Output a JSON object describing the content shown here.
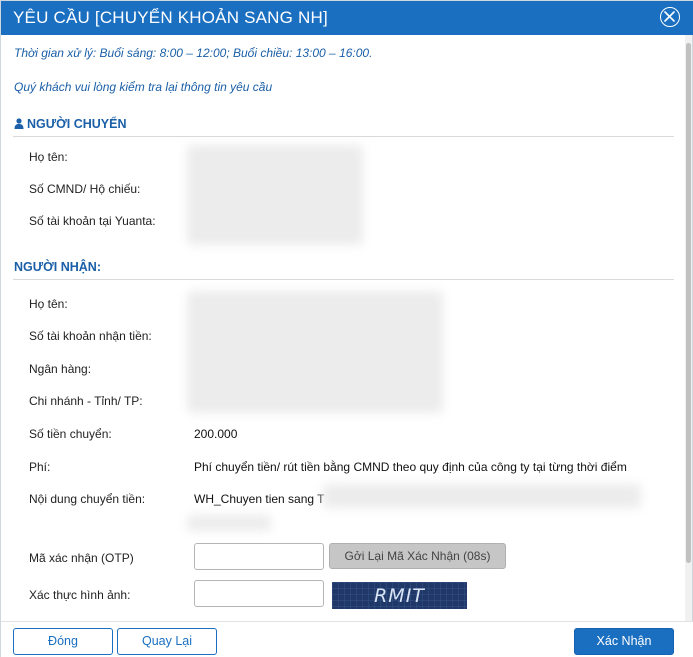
{
  "dialog": {
    "title": "YÊU CẦU [CHUYỂN KHOẢN SANG NH]"
  },
  "notes": {
    "processing_time": "Thời gian xử lý: Buổi sáng: 8:00 – 12:00; Buổi chiều: 13:00 – 16:00.",
    "verify_prompt": "Quý khách vui lòng kiểm tra lại thông tin yêu cầu"
  },
  "sender": {
    "heading": "NGƯỜI CHUYỂN",
    "fields": [
      {
        "label": "Họ tên:"
      },
      {
        "label": "Số CMND/ Hộ chiếu:"
      },
      {
        "label": "Số tài khoản tại Yuanta:"
      }
    ]
  },
  "recipient": {
    "heading": "NGƯỜI NHẬN:",
    "fields": [
      {
        "label": "Họ tên:"
      },
      {
        "label": "Số tài khoản nhận tiền:"
      },
      {
        "label": "Ngân hàng:"
      },
      {
        "label": "Chi nhánh - Tỉnh/ TP:"
      },
      {
        "label": "Số tiền chuyển:",
        "value": "200.000"
      },
      {
        "label": "Phí:",
        "value": "Phí chuyển tiền/ rút tiền bằng CMND theo quy định của công ty tại từng thời điểm"
      },
      {
        "label": "Nội dung chuyển tiền:",
        "value": "WH_Chuyen tien sang T"
      }
    ]
  },
  "verification": {
    "otp_label": "Mã xác nhận (OTP)",
    "otp_value": "",
    "resend_label": "Gởi Lại Mã Xác Nhận (08s)",
    "captcha_label": "Xác thực hình ảnh:",
    "captcha_value": "",
    "captcha_text": "RMIT"
  },
  "footer": {
    "close_label": "Đóng",
    "back_label": "Quay Lại",
    "confirm_label": "Xác Nhận"
  },
  "colors": {
    "brand_blue": "#1a6fc1",
    "note_blue": "#1a5fa8"
  }
}
